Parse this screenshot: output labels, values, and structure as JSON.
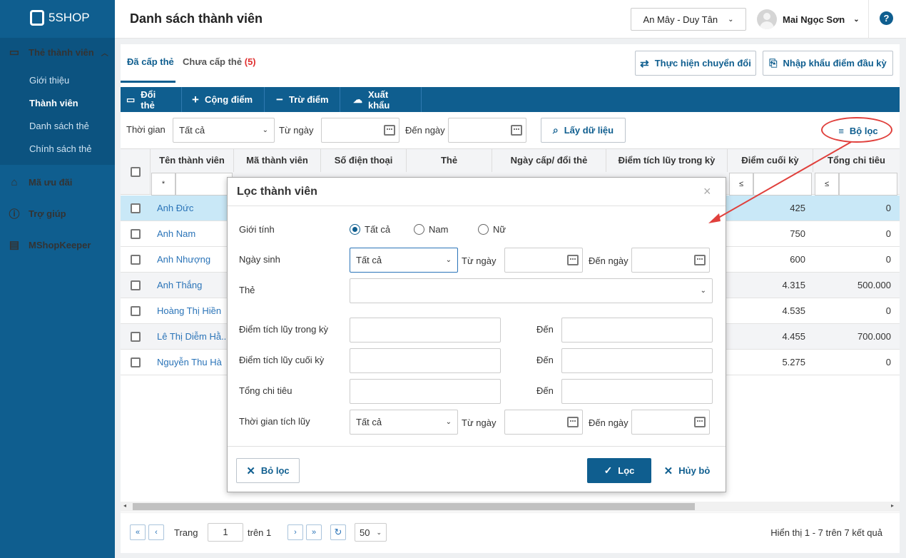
{
  "app": {
    "logo": "5SHOP"
  },
  "sidebar": {
    "group_members": "Thẻ thành viên",
    "sub_items": [
      "Giới thiệu",
      "Thành viên",
      "Danh sách thẻ",
      "Chính sách thẻ"
    ],
    "active_sub": "Thành viên",
    "group_promotions": "Mã ưu đãi",
    "group_help": "Trợ giúp",
    "group_keeper": "MShopKeeper"
  },
  "header": {
    "title": "Danh sách thành viên",
    "branch": "An Mây - Duy Tân",
    "user": "Mai Ngọc Sơn",
    "help": "?"
  },
  "tabs": {
    "issued": "Đã cấp thẻ",
    "not_issued": "Chưa cấp thẻ",
    "not_issued_count": "(5)"
  },
  "actions": {
    "convert": "Thực hiện chuyển đổi",
    "import": "Nhập khẩu điểm đầu kỳ"
  },
  "toolbar": {
    "change_card": "Đổi thẻ",
    "add_points": "Cộng điểm",
    "sub_points": "Trừ điểm",
    "export": "Xuất khẩu"
  },
  "filter_bar": {
    "time_label": "Thời gian",
    "time_value": "Tất cả",
    "from_label": "Từ ngày",
    "to_label": "Đến ngày",
    "get_data": "Lấy dữ liệu",
    "filter": "Bộ lọc"
  },
  "table": {
    "columns": [
      "Tên thành viên",
      "Mã thành viên",
      "Số điện thoại",
      "Thẻ",
      "Ngày cấp/ đổi thẻ",
      "Điểm tích lũy trong kỳ",
      "Điểm cuối kỳ",
      "Tổng chi tiêu"
    ],
    "filter_ops": {
      "name": "*",
      "final": "≤",
      "spend": "≤"
    },
    "rows": [
      {
        "name": "Anh Đức",
        "final": "425",
        "spend": "0"
      },
      {
        "name": "Anh Nam",
        "final": "750",
        "spend": "0"
      },
      {
        "name": "Anh Nhượng",
        "final": "600",
        "spend": "0"
      },
      {
        "name": "Anh Thắng",
        "final": "4.315",
        "spend": "500.000"
      },
      {
        "name": "Hoàng Thị Hiền",
        "final": "4.535",
        "spend": "0"
      },
      {
        "name": "Lê Thị Diễm Hằ...",
        "final": "4.455",
        "spend": "700.000"
      },
      {
        "name": "Nguyễn Thu Hà",
        "final": "5.275",
        "spend": "0"
      }
    ]
  },
  "pager": {
    "page_label": "Trang",
    "page": "1",
    "of_label": "trên 1",
    "page_size": "50",
    "summary": "Hiển thị 1 - 7 trên 7 kết quả"
  },
  "dialog": {
    "title": "Lọc thành viên",
    "gender_label": "Giới tính",
    "gender_options": [
      "Tất cả",
      "Nam",
      "Nữ"
    ],
    "gender_selected": "Tất cả",
    "dob_label": "Ngày sinh",
    "dob_value": "Tất cả",
    "from_label": "Từ ngày",
    "to_label": "Đến ngày",
    "card_label": "Thẻ",
    "period_points_label": "Điểm tích lũy trong kỳ",
    "final_points_label": "Điểm tích lũy cuối kỳ",
    "spend_label": "Tổng chi tiêu",
    "to_short": "Đến",
    "accum_time_label": "Thời gian tích lũy",
    "accum_time_value": "Tất cả",
    "clear": "Bỏ lọc",
    "apply": "Lọc",
    "cancel": "Hủy bỏ"
  },
  "colors": {
    "primary": "#0f5e8f",
    "link": "#2b74b8",
    "annotation": "#e0403c",
    "selected_row": "#c9e8f7"
  }
}
